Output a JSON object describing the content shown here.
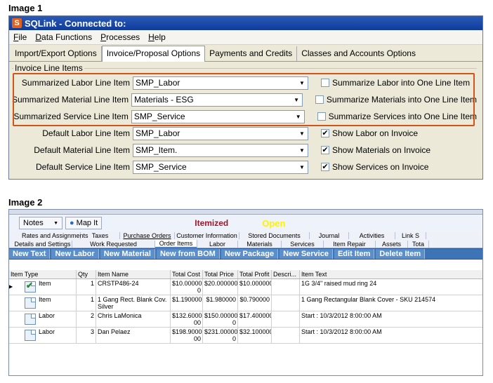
{
  "captions": {
    "image1": "Image 1",
    "image2": "Image 2"
  },
  "win1": {
    "title": "SQLink - Connected to:",
    "menu": [
      {
        "underline": "F",
        "rest": "ile"
      },
      {
        "underline": "D",
        "rest": "ata Functions"
      },
      {
        "underline": "P",
        "rest": "rocesses"
      },
      {
        "underline": "H",
        "rest": "elp"
      }
    ],
    "tabs": [
      "Import/Export Options",
      "Invoice/Proposal Options",
      "Payments and Credits",
      "Classes and Accounts Options"
    ],
    "active_tab": "Invoice/Proposal Options",
    "group_title": "Invoice Line Items",
    "rows": [
      {
        "label": "Summarized Labor Line Item",
        "value": "SMP_Labor",
        "checked": false,
        "check_label": "Summarize Labor into One Line Item"
      },
      {
        "label": "Summarized Material Line Item",
        "value": "Materials - ESG",
        "checked": false,
        "check_label": "Summarize Materials into One Line Item"
      },
      {
        "label": "Summarized Service Line Item",
        "value": "SMP_Service",
        "checked": false,
        "check_label": "Summarize Services into One Line Item"
      },
      {
        "label": "Default Labor Line Item",
        "value": "SMP_Labor",
        "checked": true,
        "check_label": "Show Labor on Invoice"
      },
      {
        "label": "Default Material Line Item",
        "value": "SMP_Item.",
        "checked": true,
        "check_label": "Show Materials on Invoice"
      },
      {
        "label": "Default Service Line Item",
        "value": "SMP_Service",
        "checked": true,
        "check_label": "Show Services on Invoice"
      }
    ],
    "highlight_color": "#d2541a"
  },
  "win2": {
    "notes_label": "Notes",
    "map_label": "Map It",
    "status_itemized": "Itemized",
    "status_open": "Open",
    "tabs_row1": [
      "Rates and Assignments",
      "Taxes",
      "Purchase Orders",
      "Customer Information",
      "Stored Documents",
      "Journal",
      "Activities",
      "Link S"
    ],
    "tabs_row2": [
      "Details and Settings",
      "Work Requested",
      "Order Items",
      "Labor",
      "Materials",
      "Services",
      "Item Repair",
      "Assets",
      "Tota"
    ],
    "actions": [
      "New Text",
      "New Labor",
      "New Material",
      "New from BOM",
      "New Package",
      "New Service",
      "Edit Item",
      "Delete Item"
    ],
    "columns": [
      "Item Type",
      "Qty",
      "Item Name",
      "Total Cost",
      "Total Price",
      "Total Profit",
      "Descri...",
      "Item Text"
    ],
    "rows": [
      {
        "type": "Item",
        "qty": "1",
        "name": "CRSTP486-24",
        "cost": "$10.00000 0",
        "price": "$20.000000",
        "profit": "$10.000000",
        "desc": "",
        "text": "1G 3/4\" raised mud ring 24",
        "checked": true
      },
      {
        "type": "Item",
        "qty": "1",
        "name": "1 Gang Rect. Blank Cov. Silver",
        "cost": "$1.190000",
        "price": "$1.980000",
        "profit": "$0.790000",
        "desc": "",
        "text": "1 Gang Rectangular Blank Cover - SKU 214574",
        "checked": false
      },
      {
        "type": "Labor",
        "qty": "2",
        "name": "Chris LaMonica",
        "cost": "$132.6000 00",
        "price": "$150.00000 0",
        "profit": "$17.400000",
        "desc": "",
        "text": "Start : 10/3/2012 8:00:00 AM",
        "checked": false
      },
      {
        "type": "Labor",
        "qty": "3",
        "name": "Dan Pelaez",
        "cost": "$198.9000 00",
        "price": "$231.00000 0",
        "profit": "$32.100000",
        "desc": "",
        "text": "Start : 10/3/2012 8:00:00 AM",
        "checked": false
      }
    ]
  }
}
